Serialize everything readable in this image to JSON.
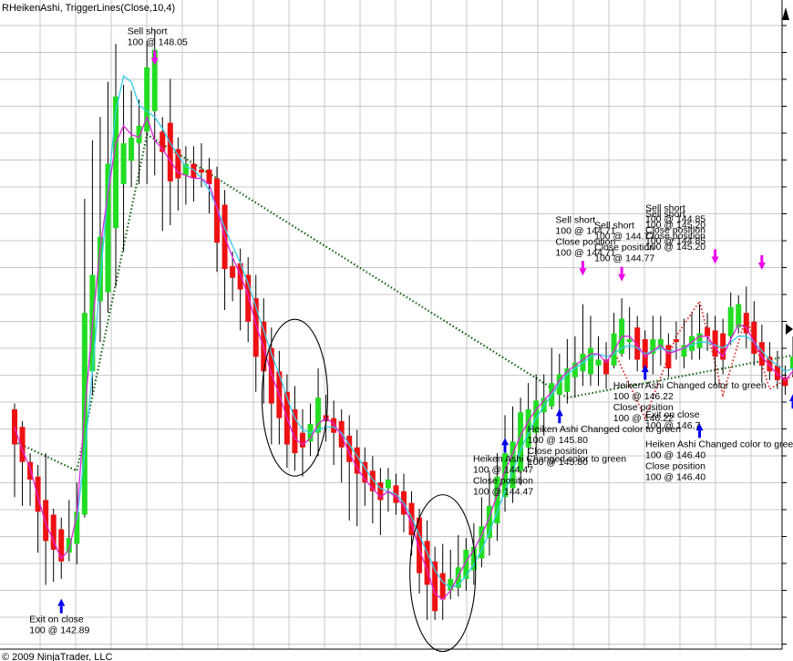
{
  "chart_data": {
    "type": "candlestick",
    "title": "RHeikenAshi, TriggerLines(Close,10,4)",
    "copyright": "© 2009 NinjaTrader, LLC",
    "colors": {
      "up_candle": "#22dd22",
      "down_candle": "#ee1111",
      "wick": "#000000",
      "fast_trigger_line": "#dd22dd",
      "slow_trigger_line": "#33ccee",
      "trendline": "#116611",
      "signal_line": "#dd2222",
      "grid": "#c8c8c8",
      "buy_arrow": "#0000ee",
      "sell_arrow": "#ee00ee"
    },
    "candles": [
      {
        "o": 148.1,
        "c": 146.9,
        "h": 148.3,
        "l": 145.1
      },
      {
        "o": 147.5,
        "c": 146.3,
        "h": 147.7,
        "l": 144.8
      },
      {
        "o": 146.3,
        "c": 145.7,
        "h": 146.6,
        "l": 144.8
      },
      {
        "o": 145.8,
        "c": 144.6,
        "h": 146.2,
        "l": 143.2
      },
      {
        "o": 145.0,
        "c": 143.6,
        "h": 146.6,
        "l": 142.1
      },
      {
        "o": 144.5,
        "c": 143.3,
        "h": 144.7,
        "l": 142.2
      },
      {
        "o": 144.0,
        "c": 142.9,
        "h": 144.4,
        "l": 142.3
      },
      {
        "o": 143.2,
        "c": 143.7,
        "h": 145.0,
        "l": 142.9
      },
      {
        "o": 143.5,
        "c": 144.6,
        "h": 145.6,
        "l": 142.8
      },
      {
        "o": 144.5,
        "c": 151.4,
        "h": 155.3,
        "l": 144.4
      },
      {
        "o": 149.4,
        "c": 152.7,
        "h": 157.3,
        "l": 148.6
      },
      {
        "o": 151.8,
        "c": 154.0,
        "h": 158.1,
        "l": 150.4
      },
      {
        "o": 152.1,
        "c": 156.5,
        "h": 159.3,
        "l": 151.4
      },
      {
        "o": 154.3,
        "c": 158.8,
        "h": 160.6,
        "l": 152.3
      },
      {
        "o": 155.8,
        "c": 157.2,
        "h": 159.2,
        "l": 153.5
      },
      {
        "o": 156.6,
        "c": 157.4,
        "h": 159.0,
        "l": 155.7
      },
      {
        "o": 157.2,
        "c": 157.8,
        "h": 158.7,
        "l": 155.8
      },
      {
        "o": 157.6,
        "c": 159.8,
        "h": 160.7,
        "l": 155.8
      },
      {
        "o": 158.3,
        "c": 160.4,
        "h": 161.1,
        "l": 156.1
      },
      {
        "o": 157.6,
        "c": 156.9,
        "h": 158.1,
        "l": 154.2
      },
      {
        "o": 157.9,
        "c": 155.9,
        "h": 159.4,
        "l": 154.4
      },
      {
        "o": 157.0,
        "c": 156.0,
        "h": 157.4,
        "l": 154.9
      },
      {
        "o": 156.1,
        "c": 156.5,
        "h": 157.1,
        "l": 155.1
      },
      {
        "o": 156.5,
        "c": 156.0,
        "h": 157.1,
        "l": 155.2
      },
      {
        "o": 156.3,
        "c": 156.2,
        "h": 157.2,
        "l": 155.7
      },
      {
        "o": 156.3,
        "c": 155.8,
        "h": 156.7,
        "l": 154.8
      },
      {
        "o": 156.0,
        "c": 153.8,
        "h": 156.4,
        "l": 152.8
      },
      {
        "o": 155.1,
        "c": 152.9,
        "h": 155.6,
        "l": 151.5
      },
      {
        "o": 153.0,
        "c": 152.6,
        "h": 153.5,
        "l": 151.8
      },
      {
        "o": 153.1,
        "c": 152.2,
        "h": 153.6,
        "l": 150.8
      },
      {
        "o": 152.7,
        "c": 151.1,
        "h": 153.3,
        "l": 150.4
      },
      {
        "o": 151.9,
        "c": 149.9,
        "h": 152.7,
        "l": 148.7
      },
      {
        "o": 151.1,
        "c": 149.4,
        "h": 151.9,
        "l": 148.3
      },
      {
        "o": 150.2,
        "c": 148.3,
        "h": 150.9,
        "l": 146.9
      },
      {
        "o": 149.4,
        "c": 147.8,
        "h": 150.1,
        "l": 146.9
      },
      {
        "o": 148.7,
        "c": 146.9,
        "h": 149.3,
        "l": 146.1
      },
      {
        "o": 148.1,
        "c": 146.6,
        "h": 148.9,
        "l": 146.0
      },
      {
        "o": 147.3,
        "c": 146.8,
        "h": 148.1,
        "l": 145.8
      },
      {
        "o": 147.0,
        "c": 147.6,
        "h": 148.3,
        "l": 146.5
      },
      {
        "o": 147.3,
        "c": 148.5,
        "h": 149.5,
        "l": 146.5
      },
      {
        "o": 147.9,
        "c": 147.7,
        "h": 148.6,
        "l": 147.0
      },
      {
        "o": 147.8,
        "c": 147.3,
        "h": 148.4,
        "l": 146.2
      },
      {
        "o": 147.7,
        "c": 146.8,
        "h": 148.1,
        "l": 145.6
      },
      {
        "o": 147.2,
        "c": 146.3,
        "h": 147.9,
        "l": 144.3
      },
      {
        "o": 146.8,
        "c": 145.9,
        "h": 147.4,
        "l": 144.1
      },
      {
        "o": 146.3,
        "c": 145.6,
        "h": 146.8,
        "l": 144.8
      },
      {
        "o": 146.0,
        "c": 145.3,
        "h": 146.5,
        "l": 144.2
      },
      {
        "o": 145.6,
        "c": 145.0,
        "h": 146.1,
        "l": 143.8
      },
      {
        "o": 145.4,
        "c": 145.7,
        "h": 146.1,
        "l": 144.6
      },
      {
        "o": 145.5,
        "c": 144.9,
        "h": 145.9,
        "l": 144.5
      },
      {
        "o": 145.3,
        "c": 144.5,
        "h": 145.9,
        "l": 143.9
      },
      {
        "o": 144.9,
        "c": 143.8,
        "h": 145.3,
        "l": 143.1
      },
      {
        "o": 144.4,
        "c": 142.5,
        "h": 144.7,
        "l": 141.8
      },
      {
        "o": 143.6,
        "c": 142.1,
        "h": 144.3,
        "l": 140.9
      },
      {
        "o": 142.9,
        "c": 141.2,
        "h": 143.4,
        "l": 140.9
      },
      {
        "o": 142.5,
        "c": 141.6,
        "h": 143.5,
        "l": 140.9
      },
      {
        "o": 141.9,
        "c": 142.3,
        "h": 143.3,
        "l": 141.6
      },
      {
        "o": 142.0,
        "c": 142.7,
        "h": 143.8,
        "l": 141.7
      },
      {
        "o": 142.3,
        "c": 143.3,
        "h": 143.7,
        "l": 141.9
      },
      {
        "o": 142.6,
        "c": 143.4,
        "h": 144.2,
        "l": 142.1
      },
      {
        "o": 143.0,
        "c": 144.1,
        "h": 145.1,
        "l": 142.7
      },
      {
        "o": 143.7,
        "c": 144.8,
        "h": 146.0,
        "l": 143.1
      },
      {
        "o": 144.2,
        "c": 145.8,
        "h": 146.6,
        "l": 143.6
      },
      {
        "o": 145.1,
        "c": 146.6,
        "h": 147.9,
        "l": 144.6
      },
      {
        "o": 145.4,
        "c": 147.0,
        "h": 148.2,
        "l": 144.9
      },
      {
        "o": 146.0,
        "c": 148.0,
        "h": 148.5,
        "l": 145.5
      },
      {
        "o": 146.8,
        "c": 148.1,
        "h": 149.0,
        "l": 146.1
      },
      {
        "o": 147.3,
        "c": 148.4,
        "h": 149.3,
        "l": 146.5
      },
      {
        "o": 148.0,
        "c": 148.5,
        "h": 149.3,
        "l": 147.2
      },
      {
        "o": 148.2,
        "c": 149.0,
        "h": 150.2,
        "l": 148.1
      },
      {
        "o": 148.6,
        "c": 149.3,
        "h": 150.0,
        "l": 147.8
      },
      {
        "o": 148.7,
        "c": 149.5,
        "h": 150.5,
        "l": 148.3
      },
      {
        "o": 149.2,
        "c": 149.7,
        "h": 150.6,
        "l": 148.5
      },
      {
        "o": 149.4,
        "c": 150.0,
        "h": 151.7,
        "l": 148.9
      },
      {
        "o": 149.3,
        "c": 150.2,
        "h": 151.3,
        "l": 148.9
      },
      {
        "o": 149.6,
        "c": 149.8,
        "h": 150.6,
        "l": 148.9
      },
      {
        "o": 149.8,
        "c": 149.3,
        "h": 150.4,
        "l": 148.8
      },
      {
        "o": 149.6,
        "c": 150.7,
        "h": 151.4,
        "l": 149.5
      },
      {
        "o": 150.0,
        "c": 151.2,
        "h": 151.9,
        "l": 149.9
      },
      {
        "o": 150.4,
        "c": 150.5,
        "h": 151.6,
        "l": 149.8
      },
      {
        "o": 150.9,
        "c": 149.8,
        "h": 151.3,
        "l": 149.4
      },
      {
        "o": 150.5,
        "c": 149.5,
        "h": 150.8,
        "l": 149.1
      },
      {
        "o": 150.0,
        "c": 150.5,
        "h": 151.3,
        "l": 149.3
      },
      {
        "o": 150.2,
        "c": 150.5,
        "h": 151.3,
        "l": 149.6
      },
      {
        "o": 150.3,
        "c": 149.5,
        "h": 150.7,
        "l": 149.2
      },
      {
        "o": 150.5,
        "c": 150.4,
        "h": 151.1,
        "l": 149.8
      },
      {
        "o": 149.9,
        "c": 150.3,
        "h": 151.2,
        "l": 149.5
      },
      {
        "o": 150.1,
        "c": 150.6,
        "h": 151.4,
        "l": 149.8
      },
      {
        "o": 150.2,
        "c": 150.7,
        "h": 151.7,
        "l": 149.8
      },
      {
        "o": 150.9,
        "c": 150.6,
        "h": 151.4,
        "l": 150.1
      },
      {
        "o": 150.8,
        "c": 149.9,
        "h": 151.3,
        "l": 148.9
      },
      {
        "o": 150.7,
        "c": 149.8,
        "h": 151.2,
        "l": 149.3
      },
      {
        "o": 150.6,
        "c": 151.6,
        "h": 152.1,
        "l": 150.3
      },
      {
        "o": 150.9,
        "c": 151.7,
        "h": 152.0,
        "l": 150.7
      },
      {
        "o": 151.4,
        "c": 150.7,
        "h": 152.3,
        "l": 150.2
      },
      {
        "o": 151.1,
        "c": 150.0,
        "h": 151.8,
        "l": 149.6
      },
      {
        "o": 150.4,
        "c": 149.6,
        "h": 151.0,
        "l": 149.0
      },
      {
        "o": 149.9,
        "c": 149.4,
        "h": 150.4,
        "l": 149.1
      },
      {
        "o": 149.6,
        "c": 149.1,
        "h": 150.1,
        "l": 148.8
      },
      {
        "o": 149.2,
        "c": 148.9,
        "h": 149.6,
        "l": 148.6
      },
      {
        "o": 149.5,
        "c": 149.9,
        "h": 150.6,
        "l": 149.2
      }
    ],
    "fast_trigger_line": [
      147.5,
      146.7,
      146.1,
      145.1,
      144.2,
      143.6,
      143.0,
      143.3,
      144.5,
      148.0,
      151.0,
      153.6,
      155.5,
      157.2,
      157.8,
      157.5,
      157.4,
      158.1,
      157.3,
      157.0,
      156.6,
      156.2,
      156.1,
      156.0,
      156.0,
      155.8,
      155.0,
      154.0,
      153.3,
      152.7,
      152.0,
      151.0,
      150.2,
      149.3,
      148.6,
      147.8,
      147.1,
      146.9,
      147.1,
      147.6,
      147.8,
      147.6,
      147.2,
      146.6,
      146.1,
      145.7,
      145.4,
      145.1,
      145.3,
      145.1,
      144.8,
      144.2,
      143.3,
      142.6,
      141.8,
      141.6,
      141.9,
      142.4,
      142.9,
      143.3,
      143.8,
      144.4,
      145.2,
      146.0,
      146.6,
      147.2,
      147.7,
      148.1,
      148.4,
      148.7,
      149.1,
      149.4,
      149.6,
      149.8,
      150.0,
      150.0,
      149.7,
      150.1,
      150.6,
      150.6,
      150.3,
      149.9,
      150.1,
      150.3,
      150.0,
      150.1,
      150.2,
      150.4,
      150.6,
      150.6,
      150.2,
      149.9,
      150.5,
      151.0,
      150.9,
      150.4,
      149.9,
      149.6,
      149.3,
      149.1,
      149.4
    ],
    "slow_trigger_line": [
      null,
      null,
      null,
      null,
      null,
      null,
      null,
      null,
      144.3,
      146.6,
      149.4,
      152.5,
      155.6,
      158.3,
      159.5,
      159.3,
      158.5,
      158.3,
      158.1,
      157.7,
      157.2,
      156.8,
      156.4,
      156.3,
      156.0,
      155.6,
      155.0,
      154.3,
      153.7,
      153.1,
      152.4,
      151.6,
      150.8,
      150.0,
      149.3,
      148.5,
      147.8,
      147.4,
      147.3,
      147.4,
      147.5,
      147.5,
      147.3,
      146.9,
      146.5,
      146.1,
      145.7,
      145.4,
      145.3,
      145.2,
      144.9,
      144.4,
      143.8,
      143.2,
      142.6,
      142.2,
      142.0,
      142.1,
      142.4,
      142.8,
      143.3,
      143.9,
      144.6,
      145.3,
      146.0,
      146.7,
      147.3,
      147.8,
      148.2,
      148.6,
      149.0,
      149.3,
      149.5,
      149.7,
      149.9,
      150.0,
      149.9,
      150.0,
      150.2,
      150.3,
      150.2,
      150.0,
      150.1,
      150.2,
      150.1,
      150.1,
      150.2,
      150.3,
      150.4,
      150.4,
      150.3,
      150.2,
      150.4,
      150.6,
      150.6,
      150.4,
      150.1,
      149.8,
      149.6,
      149.4,
      149.5
    ],
    "trendline": {
      "start": [
        0,
        147.0
      ],
      "end": [
        101,
        150.0
      ],
      "via": [
        {
          "i": 8,
          "p": 146.0
        },
        {
          "i": 17,
          "p": 157.5
        },
        {
          "i": 71,
          "p": 148.5
        }
      ]
    },
    "annotations": [
      {
        "bar": 6,
        "price": 141.5,
        "lines": [
          "Exit on close",
          "100 @ 142.89"
        ],
        "arrow": "buy-exit"
      },
      {
        "bar": 18,
        "price": 160.0,
        "lines": [
          "Sell short",
          "100 @ 148.05"
        ],
        "arrow": "sell"
      },
      {
        "bar": 63,
        "price": 147.0,
        "lines": [
          "Heiken Ashi Changed color to green",
          "100 @ 144.47",
          "Close position",
          "100 @ 144.47"
        ],
        "arrow": "buy"
      },
      {
        "bar": 70,
        "price": 148.0,
        "lines": [
          "Heiken Ashi Changed color to green",
          "100 @ 145.80",
          "Close position",
          "100 @ 145.80"
        ],
        "arrow": "buy"
      },
      {
        "bar": 73,
        "price": 152.8,
        "lines": [
          "Sell short",
          "100 @ 144.71",
          "Close position",
          "100 @ 144.71"
        ],
        "arrow": "sell"
      },
      {
        "bar": 78,
        "price": 152.6,
        "lines": [
          "Sell short",
          "100 @ 144.77",
          "Close position",
          "100 @ 144.77"
        ],
        "arrow": "sell"
      },
      {
        "bar": 81,
        "price": 149.5,
        "lines": [
          "Heiken Ashi Changed color to green",
          "100 @ 146.22",
          "Close position",
          "100 @ 146.22"
        ],
        "arrow": "buy"
      },
      {
        "bar": 88,
        "price": 147.5,
        "lines": [
          "Heiken Ashi Changed color to green",
          "100 @ 146.40",
          "Close position",
          "100 @ 146.40"
        ],
        "arrow": "buy"
      },
      {
        "bar": 90,
        "price": 153.2,
        "lines": [
          "Sell short",
          "100 @ 144.85",
          "Close position",
          "100 @ 144.85"
        ],
        "arrow": "sell"
      },
      {
        "bar": 96,
        "price": 153.0,
        "lines": [
          "Sell short",
          "100 @ 145.20",
          "Close position",
          "100 @ 145.20"
        ],
        "arrow": "sell"
      },
      {
        "bar": 100,
        "price": 148.5,
        "lines": [
          "Exit on close",
          "100 @ 146.7"
        ],
        "arrow": "buy-exit"
      }
    ],
    "highlight_circles": [
      {
        "bar": 36,
        "price": 148.5
      },
      {
        "bar": 55,
        "price": 142.5
      }
    ],
    "ylim": [
      139.9,
      162.1
    ]
  }
}
